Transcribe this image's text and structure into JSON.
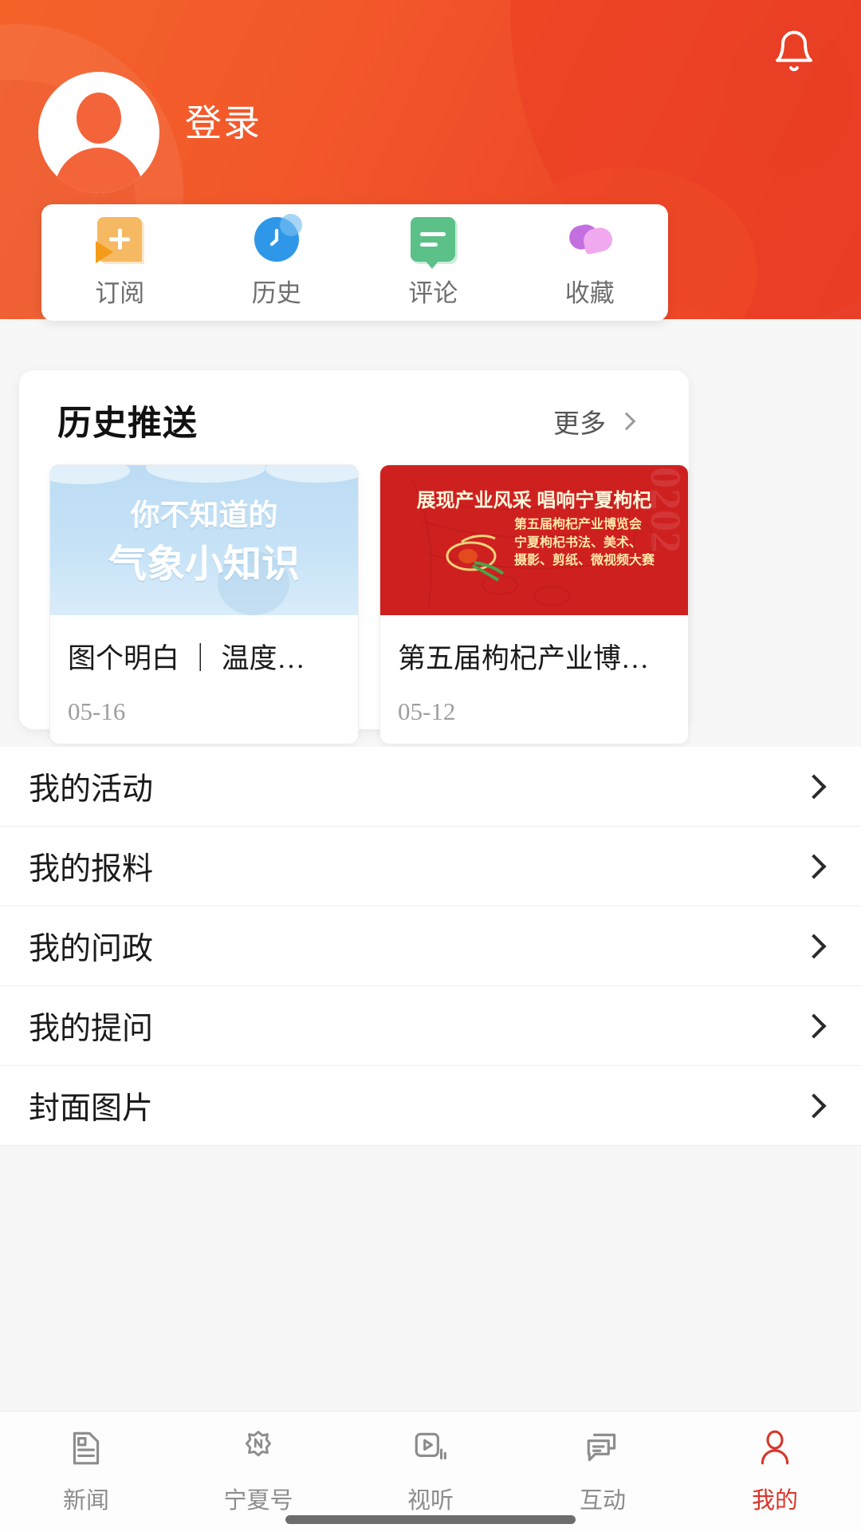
{
  "header": {
    "login_label": "登录",
    "bell_icon": "bell-icon",
    "avatar_icon": "default-avatar-icon",
    "bg_color_start": "#f4622a",
    "bg_color_end": "#e8402a"
  },
  "quick_actions": [
    {
      "label": "订阅",
      "icon": "subscribe-icon"
    },
    {
      "label": "历史",
      "icon": "history-clock-icon"
    },
    {
      "label": "评论",
      "icon": "comment-icon"
    },
    {
      "label": "收藏",
      "icon": "favorite-icon"
    }
  ],
  "history_push": {
    "title": "历史推送",
    "more_label": "更多",
    "more_icon": "chevron-right-icon",
    "items": [
      {
        "title": "图个明白 ｜ 温度…",
        "date": "05-16",
        "thumb_type": "weather-poster",
        "thumb_line1": "你不知道的",
        "thumb_line2": "气象小知识",
        "thumb_color": "#c6e2f6"
      },
      {
        "title": "第五届枸杞产业博…",
        "date": "05-12",
        "thumb_type": "goji-poster",
        "thumb_headline": "展现产业风采  唱响宁夏枸杞",
        "thumb_sub1": "第五届枸杞产业博览会",
        "thumb_sub2": "宁夏枸杞书法、美术、",
        "thumb_sub3": "摄影、剪纸、微视频大赛",
        "thumb_color": "#cf2020"
      }
    ]
  },
  "menu": [
    {
      "label": "我的活动",
      "icon": "chevron-right-icon"
    },
    {
      "label": "我的报料",
      "icon": "chevron-right-icon"
    },
    {
      "label": "我的问政",
      "icon": "chevron-right-icon"
    },
    {
      "label": "我的提问",
      "icon": "chevron-right-icon"
    },
    {
      "label": "封面图片",
      "icon": "chevron-right-icon"
    }
  ],
  "tabbar": {
    "active_color": "#d9352a",
    "inactive_color": "#8c8c8c",
    "items": [
      {
        "label": "新闻",
        "icon": "news-document-icon",
        "active": false
      },
      {
        "label": "宁夏号",
        "icon": "ningxia-n-icon",
        "active": false
      },
      {
        "label": "视听",
        "icon": "video-play-icon",
        "active": false
      },
      {
        "label": "互动",
        "icon": "chat-bubbles-icon",
        "active": false
      },
      {
        "label": "我的",
        "icon": "person-icon",
        "active": true
      }
    ]
  }
}
